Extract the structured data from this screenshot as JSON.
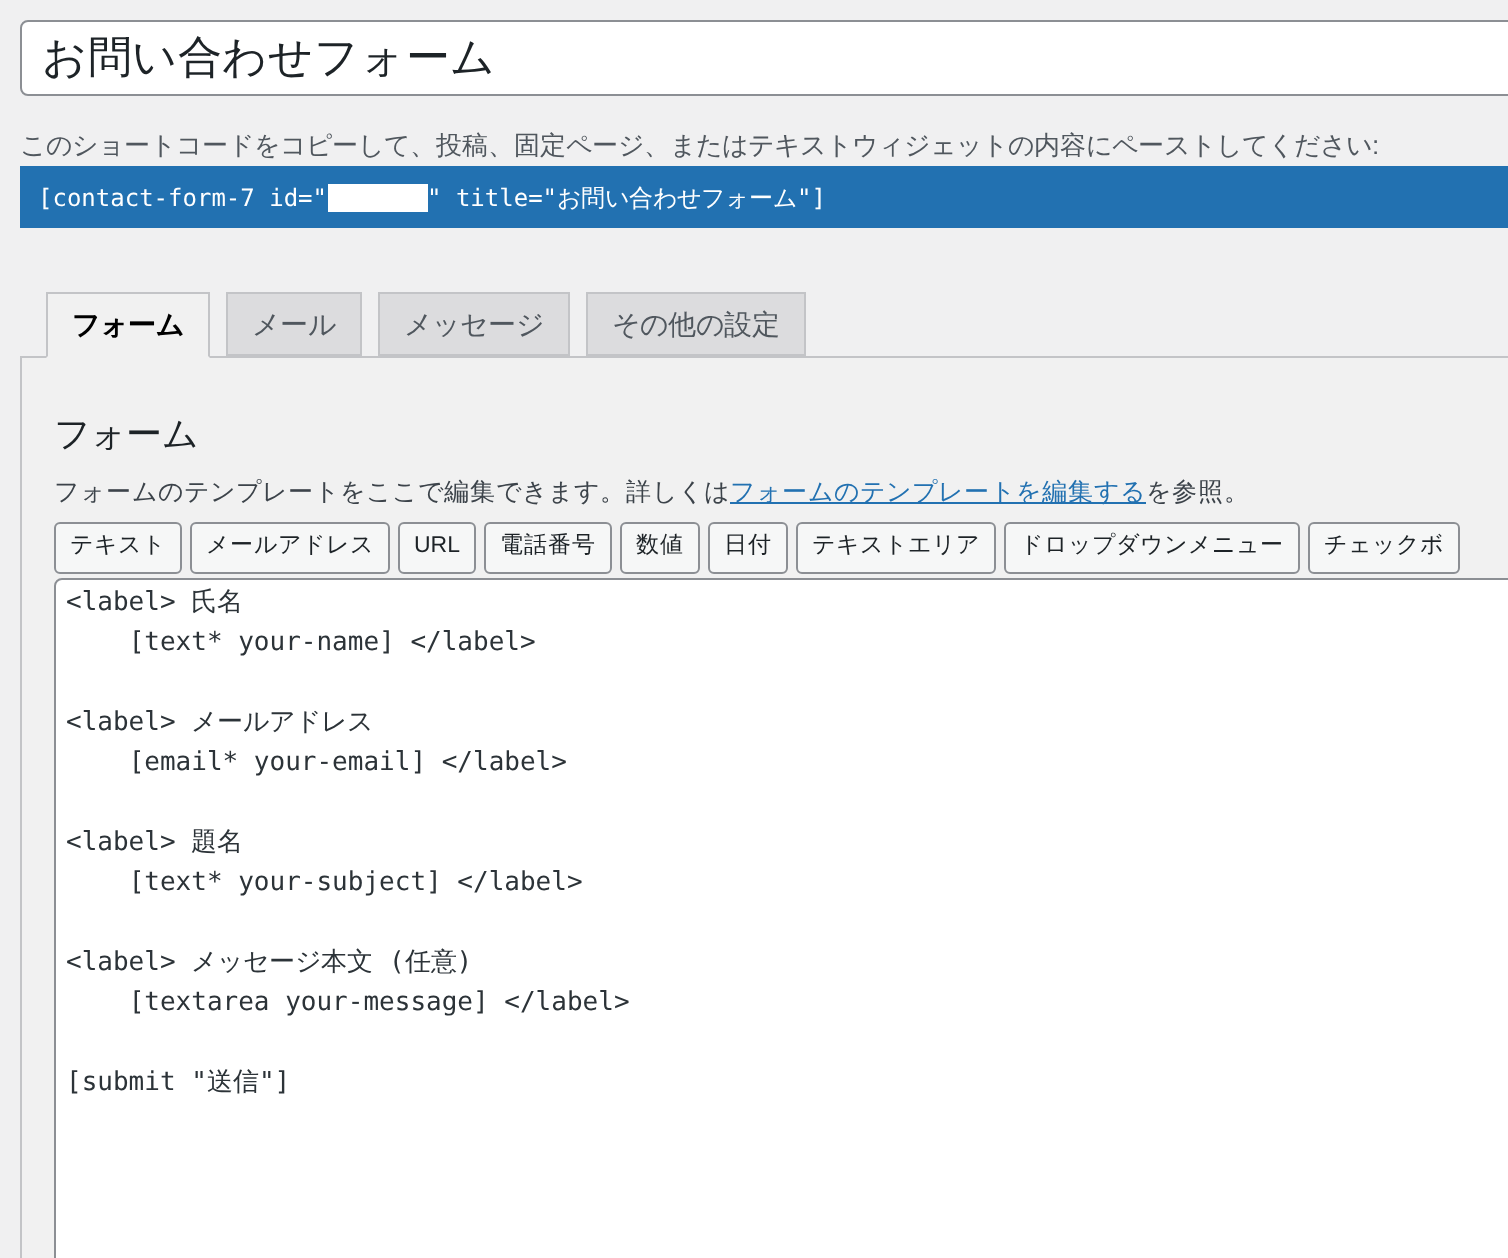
{
  "title_field": {
    "value": "お問い合わせフォーム"
  },
  "shortcode_hint": "このショートコードをコピーして、投稿、固定ページ、またはテキストウィジェットの内容にペーストしてください:",
  "shortcode": {
    "before": "[contact-form-7 id=\"",
    "redacted": true,
    "after": "\" title=\"お問い合わせフォーム\"]"
  },
  "tabs": [
    {
      "label": "フォーム",
      "selected": true
    },
    {
      "label": "メール",
      "selected": false
    },
    {
      "label": "メッセージ",
      "selected": false
    },
    {
      "label": "その他の設定",
      "selected": false
    }
  ],
  "panel": {
    "heading": "フォーム",
    "description": {
      "before": "フォームのテンプレートをここで編集できます。詳しくは",
      "link": "フォームのテンプレートを編集する",
      "after": "を参照。"
    },
    "tag_buttons": [
      "テキスト",
      "メールアドレス",
      "URL",
      "電話番号",
      "数値",
      "日付",
      "テキストエリア",
      "ドロップダウンメニュー",
      "チェックボ"
    ],
    "template": "<label> 氏名\n    [text* your-name] </label>\n\n<label> メールアドレス\n    [email* your-email] </label>\n\n<label> 題名\n    [text* your-subject] </label>\n\n<label> メッセージ本文 (任意)\n    [textarea your-message] </label>\n\n[submit \"送信\"]"
  }
}
